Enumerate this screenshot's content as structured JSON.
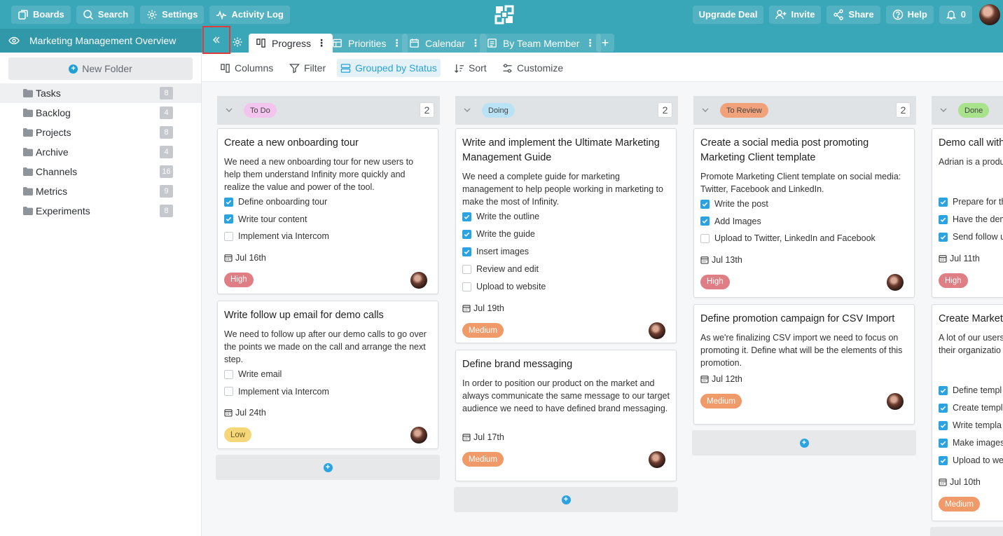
{
  "topbar": {
    "boards": "Boards",
    "search": "Search",
    "settings": "Settings",
    "activity_log": "Activity Log",
    "upgrade": "Upgrade Deal",
    "invite": "Invite",
    "share": "Share",
    "help": "Help",
    "notifications": "0"
  },
  "sidebar": {
    "title": "Marketing Management Overview",
    "new_folder": "New Folder",
    "folders": [
      {
        "name": "Tasks",
        "count": "8"
      },
      {
        "name": "Backlog",
        "count": "4"
      },
      {
        "name": "Projects",
        "count": "8"
      },
      {
        "name": "Archive",
        "count": "4"
      },
      {
        "name": "Channels",
        "count": "16"
      },
      {
        "name": "Metrics",
        "count": "9"
      },
      {
        "name": "Experiments",
        "count": "8"
      }
    ]
  },
  "tabs": [
    {
      "label": "Progress"
    },
    {
      "label": "Priorities"
    },
    {
      "label": "Calendar"
    },
    {
      "label": "By Team Member"
    }
  ],
  "toolbar": {
    "columns": "Columns",
    "filter": "Filter",
    "grouped": "Grouped by Status",
    "sort": "Sort",
    "customize": "Customize"
  },
  "columns": [
    {
      "status": "To Do",
      "status_color": "#f3c4ee",
      "count": "2",
      "cards": [
        {
          "title": "Create a new onboarding tour",
          "desc": "We need a new onboarding tour for new users to help them understand Infinity more quickly and realize the value and power of the tool.",
          "checks": [
            {
              "t": "Define onboarding tour",
              "on": true
            },
            {
              "t": "Write tour content",
              "on": true
            },
            {
              "t": "Implement via Intercom",
              "on": false
            }
          ],
          "due": "Jul 16th",
          "priority": "High"
        },
        {
          "title": "Write follow up email for demo calls",
          "desc": "We need to follow up after our demo calls to go over the points we made on the call and arrange the next step.",
          "checks": [
            {
              "t": "Write email",
              "on": false
            },
            {
              "t": "Implement via Intercom",
              "on": false
            }
          ],
          "due": "Jul 24th",
          "priority": "Low"
        }
      ]
    },
    {
      "status": "Doing",
      "status_color": "#b9e3f5",
      "count": "2",
      "cards": [
        {
          "title": "Write and implement the Ultimate Marketing Management Guide",
          "desc": "We need a complete guide for marketing management to help people working in marketing to make the most of Infinity.",
          "checks": [
            {
              "t": "Write the outline",
              "on": true
            },
            {
              "t": "Write the guide",
              "on": true
            },
            {
              "t": "Insert images",
              "on": true
            },
            {
              "t": "Review and edit",
              "on": false
            },
            {
              "t": "Upload to website",
              "on": false
            }
          ],
          "due": "Jul 19th",
          "priority": "Medium"
        },
        {
          "title": "Define brand messaging",
          "desc": "In order to position our product on the market and always communicate the same message to our target audience we need to have defined brand messaging.",
          "checks": [],
          "due": "Jul 17th",
          "priority": "Medium"
        }
      ]
    },
    {
      "status": "To Review",
      "status_color": "#f2a27a",
      "count": "2",
      "cards": [
        {
          "title": "Create a social media post promoting Marketing Client template",
          "desc": "Promote Marketing Client template on social media: Twitter, Facebook and LinkedIn.",
          "checks": [
            {
              "t": "Write the post",
              "on": true
            },
            {
              "t": "Add Images",
              "on": true
            },
            {
              "t": "Upload to Twitter, LinkedIn and Facebook",
              "on": false
            }
          ],
          "due": "Jul 13th",
          "priority": "High"
        },
        {
          "title": "Define promotion campaign for CSV Import",
          "desc": "As we're finalizing CSV import we need to focus on promoting it. Define what will be the elements of this promotion.",
          "checks": [],
          "due": "Jul 12th",
          "priority": "Medium"
        }
      ]
    },
    {
      "status": "Done",
      "status_color": "#a8e28a",
      "count": "",
      "cards": [
        {
          "title": "Demo call with",
          "desc": "Adrian is a produ product team. He and some tips ho",
          "checks": [
            {
              "t": "Prepare for th",
              "on": true
            },
            {
              "t": "Have the dem",
              "on": true
            },
            {
              "t": "Send follow u",
              "on": true
            }
          ],
          "due": "Jul 11th",
          "priority": "High"
        },
        {
          "title": "Create Market",
          "desc": "A lot of our users niche, we need t marketing client their organizatio",
          "checks": [
            {
              "t": "Define templ",
              "on": true
            },
            {
              "t": "Create templ",
              "on": true
            },
            {
              "t": "Write templa",
              "on": true
            },
            {
              "t": "Make images",
              "on": true
            },
            {
              "t": "Upload to we",
              "on": true
            }
          ],
          "due": "Jul 10th",
          "priority": "Medium"
        }
      ]
    }
  ]
}
